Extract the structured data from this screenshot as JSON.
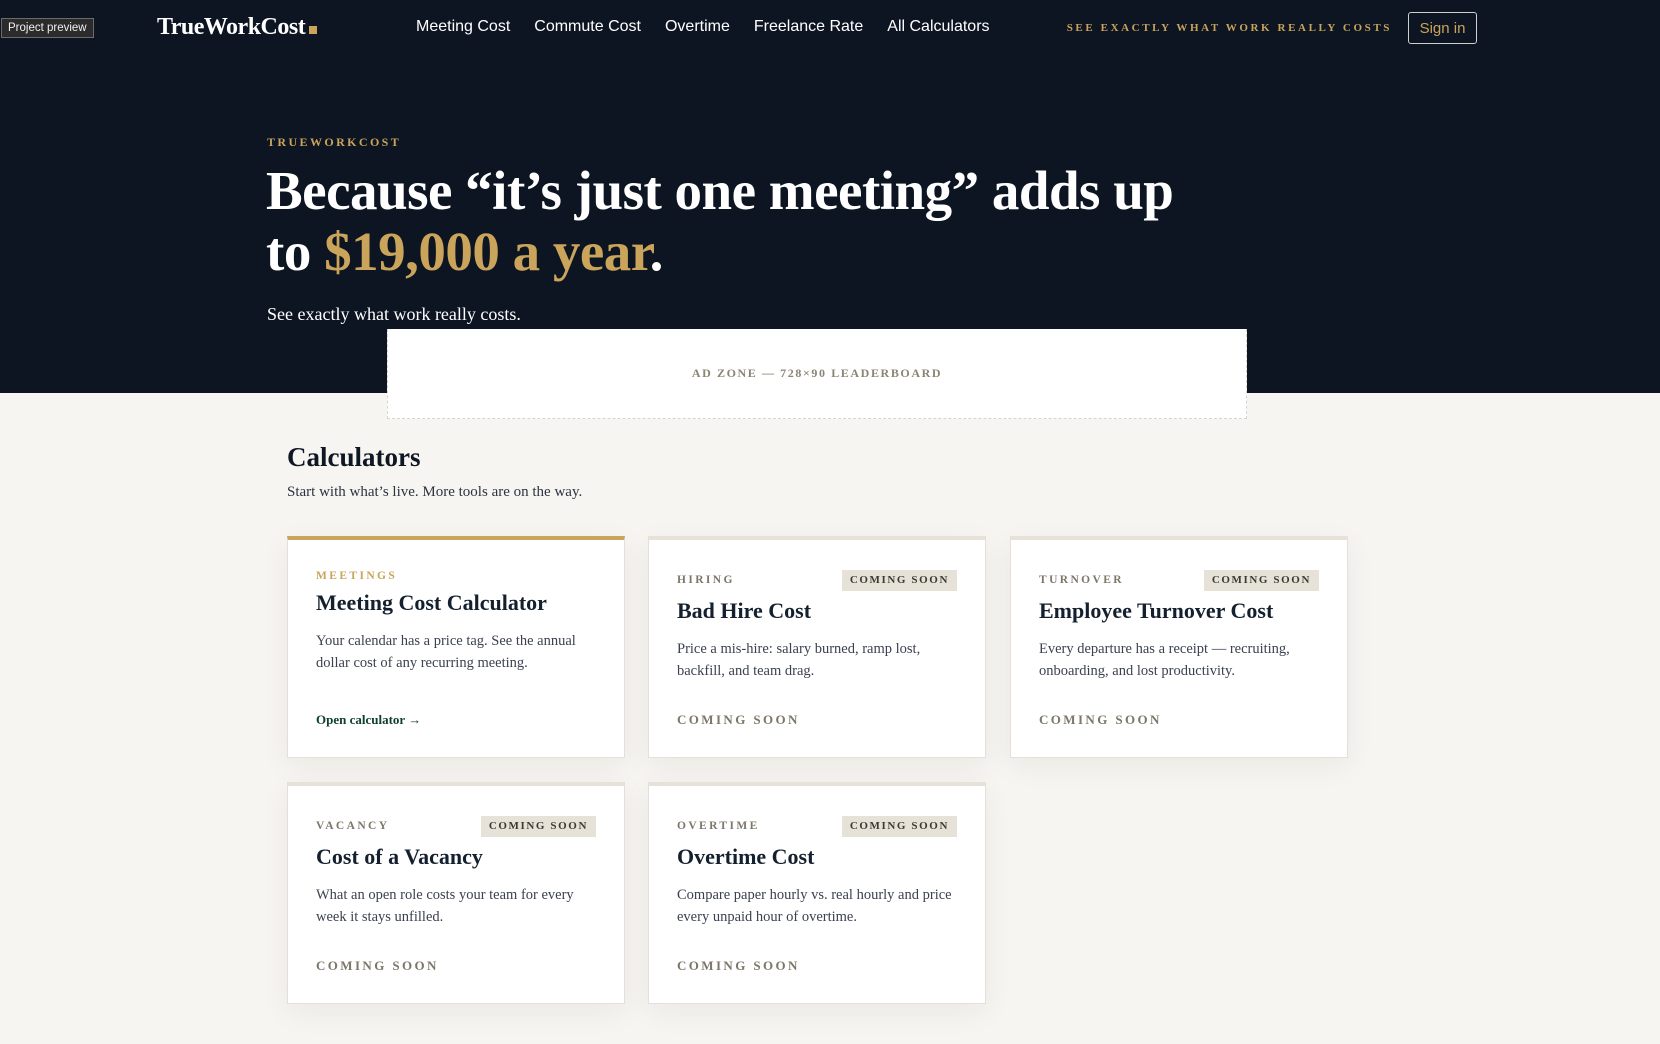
{
  "preview_badge": "Project preview",
  "brand": {
    "name": "TrueWorkCost",
    "accent_color": "#c9a45a"
  },
  "nav": {
    "items": [
      "Meeting Cost",
      "Commute Cost",
      "Overtime",
      "Freelance Rate",
      "All Calculators"
    ],
    "tagline": "SEE EXACTLY WHAT WORK REALLY COSTS",
    "signin_label": "Sign in"
  },
  "hero": {
    "eyebrow": "TRUEWORKCOST",
    "headline_part1": "Because “it’s just one meeting” adds up to ",
    "headline_accent": "$19,000 a year",
    "headline_end": ".",
    "subhead": "See exactly what work really costs."
  },
  "ad": {
    "label": "AD ZONE — 728×90 LEADERBOARD"
  },
  "section": {
    "title": "Calculators",
    "subtitle": "Start with what’s live. More tools are on the way."
  },
  "cards": [
    {
      "category": "MEETINGS",
      "title": "Meeting Cost Calculator",
      "description": "Your calendar has a price tag. See the annual dollar cost of any recurring meeting.",
      "cta": "Open calculator →"
    },
    {
      "category": "HIRING",
      "badge": "COMING SOON",
      "title": "Bad Hire Cost",
      "description": "Price a mis-hire: salary burned, ramp lost, backfill, and team drag.",
      "status": "COMING SOON"
    },
    {
      "category": "TURNOVER",
      "badge": "COMING SOON",
      "title": "Employee Turnover Cost",
      "description": "Every departure has a receipt — recruiting, onboarding, and lost productivity.",
      "status": "COMING SOON"
    },
    {
      "category": "VACANCY",
      "badge": "COMING SOON",
      "title": "Cost of a Vacancy",
      "description": "What an open role costs your team for every week it stays unfilled.",
      "status": "COMING SOON"
    },
    {
      "category": "OVERTIME",
      "badge": "COMING SOON",
      "title": "Overtime Cost",
      "description": "Compare paper hourly vs. real hourly and price every unpaid hour of overtime.",
      "status": "COMING SOON"
    }
  ]
}
